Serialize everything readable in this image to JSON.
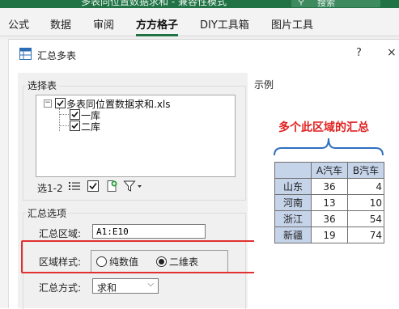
{
  "ribbon": {
    "title": "多表同位置数据求和 - 兼容性模式",
    "search_label": "搜索",
    "tabs": [
      "公式",
      "数据",
      "审阅",
      "方方格子",
      "DIY工具箱",
      "图片工具"
    ],
    "active_tab": "方方格子"
  },
  "dialog": {
    "title": "汇总多表",
    "help": "?",
    "close": "×"
  },
  "select_table": {
    "label": "选择表",
    "root": "多表同位置数据求和.xls",
    "children": [
      "一库",
      "二库"
    ],
    "toolbar_label": "选1-2"
  },
  "options": {
    "label": "汇总选项",
    "area_label": "汇总区域:",
    "area_value": "A1:E10",
    "style_label": "区域样式:",
    "style_options": [
      "纯数值",
      "二维表"
    ],
    "style_selected": "二维表",
    "method_label": "汇总方式:",
    "method_value": "求和"
  },
  "example": {
    "label": "示例",
    "title": "多个此区域的汇总",
    "headers": [
      "",
      "A汽车",
      "B汽车"
    ],
    "rows": [
      [
        "山东",
        "36",
        "4"
      ],
      [
        "河南",
        "13",
        "10"
      ],
      [
        "浙江",
        "36",
        "54"
      ],
      [
        "新疆",
        "19",
        "74"
      ]
    ]
  },
  "colors": {
    "excel_green": "#217346",
    "highlight_red": "#e03131",
    "header_blue": "#c6d4ea"
  }
}
